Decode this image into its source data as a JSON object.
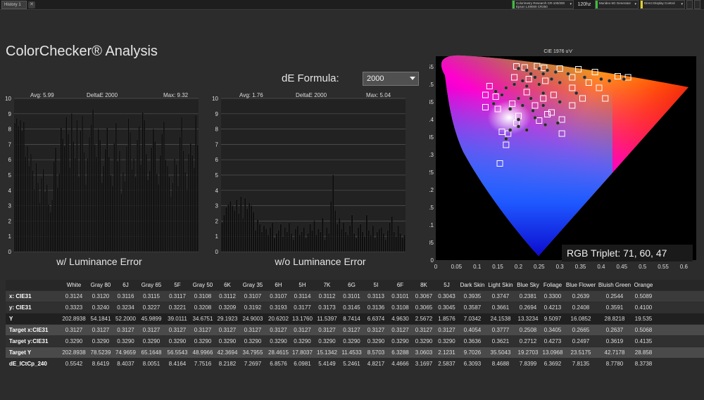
{
  "tab": {
    "label": "History 1"
  },
  "devices": [
    {
      "line1": "Colorimetry Research CR-100/200",
      "line2": "Epson LS9000 CR250",
      "color": "#3bbf3b"
    },
    {
      "line1": "Murideo 6G Generator",
      "line2": "",
      "color": "#3bbf3b"
    },
    {
      "line1": "Direct Display Control",
      "line2": "",
      "color": "#e3d02a"
    }
  ],
  "refresh": "120hz",
  "title": "ColorChecker® Analysis",
  "de_formula": {
    "label": "dE Formula:",
    "value": "2000"
  },
  "charts": [
    {
      "avg": "Avg: 5.99",
      "name": "DeltaE 2000",
      "max": "Max: 9.32",
      "caption": "w/ Luminance Error"
    },
    {
      "avg": "Avg: 1.76",
      "name": "DeltaE 2000",
      "max": "Max: 5.04",
      "caption": "w/o Luminance Error"
    }
  ],
  "chart_data": [
    {
      "type": "bar",
      "title": "DeltaE 2000",
      "ylim": [
        0,
        10
      ],
      "yticks": [
        "0",
        "1",
        "2",
        "3",
        "4",
        "5",
        "6",
        "7",
        "8",
        "9",
        "10"
      ],
      "values": [
        8.4,
        8.7,
        8.2,
        8.6,
        7.9,
        8.5,
        6.2,
        6.9,
        5.6,
        6.4,
        5.3,
        4.1,
        5.8,
        4.5,
        3.2,
        4.8,
        5.4,
        3.9,
        4.4,
        3.1,
        2.6,
        3.4,
        5.9,
        6.8,
        4.2,
        5.1,
        8.1,
        7.4,
        6.9,
        8.8,
        7.7,
        5.5,
        9.0,
        7.2,
        6.1,
        8.6,
        4.9,
        7.9,
        8.9,
        6.5,
        4.4,
        6.1,
        7.5,
        8.3,
        9.3,
        7.0,
        6.2,
        8.0,
        7.3,
        4.5,
        5.6,
        6.7,
        8.1,
        6.2,
        5.0,
        4.3,
        7.1,
        8.4,
        5.9,
        6.6,
        3.8,
        5.2,
        4.6,
        6.9,
        8.7,
        7.8,
        5.4,
        6.1,
        4.9,
        7.3,
        8.2,
        5.7,
        9.1,
        8.6,
        6.4,
        4.7,
        5.3,
        6.8,
        8.0,
        7.2,
        5.1,
        4.4,
        6.3,
        7.7,
        8.5,
        6.0,
        5.6,
        4.9,
        3.6,
        4.5,
        6.1,
        5.7,
        4.3,
        7.5,
        8.8,
        6.6,
        5.2,
        4.1,
        6.4,
        7.1,
        6.3,
        5.5,
        8.9,
        7.0
      ]
    },
    {
      "type": "bar",
      "title": "DeltaE 2000",
      "ylim": [
        0,
        10
      ],
      "yticks": [
        "0",
        "1",
        "2",
        "3",
        "4",
        "5",
        "6",
        "7",
        "8",
        "9",
        "10"
      ],
      "values": [
        1.9,
        2.4,
        2.9,
        3.1,
        3.3,
        3.0,
        2.7,
        3.4,
        2.5,
        3.6,
        2.2,
        3.5,
        2.8,
        3.2,
        3.0,
        2.6,
        1.4,
        2.1,
        1.8,
        1.3,
        1.7,
        1.5,
        1.1,
        1.6,
        1.9,
        0.9,
        1.2,
        1.4,
        1.8,
        1.0,
        1.6,
        1.3,
        1.9,
        1.2,
        0.8,
        1.5,
        1.7,
        1.1,
        1.3,
        1.6,
        0.9,
        1.2,
        1.8,
        1.4,
        2.0,
        1.1,
        1.5,
        1.3,
        2.2,
        0.8,
        1.6,
        1.2,
        3.3,
        5.0,
        2.7,
        1.8,
        2.2,
        1.5,
        1.9,
        1.3,
        1.1,
        1.7,
        2.4,
        1.2,
        0.9,
        1.6,
        1.8,
        1.3,
        1.0,
        2.4,
        1.4,
        1.1,
        1.7,
        0.9,
        1.3,
        1.5,
        1.6,
        1.2,
        0.8,
        1.4,
        1.9,
        2.3,
        1.3,
        1.0,
        1.7,
        1.2,
        0.9,
        1.1
      ]
    }
  ],
  "cie": {
    "title": "CIE 1976 u'v'",
    "x_ticks": [
      "0",
      "0.05",
      "0.1",
      "0.15",
      "0.2",
      "0.25",
      "0.3",
      "0.35",
      "0.4",
      "0.45",
      "0.5",
      "0.55",
      "0.6"
    ],
    "y_ticks": [
      "0",
      "0.05",
      "0.1",
      "0.15",
      "0.2",
      "0.25",
      "0.3",
      "0.35",
      "0.4",
      "0.45",
      "0.5",
      "0.55"
    ],
    "rgb_triplet": "RGB Triplet: 71, 60, 47"
  },
  "table": {
    "columns": [
      "White",
      "Gray 80",
      "6J",
      "Gray 65",
      "5F",
      "Gray 50",
      "6K",
      "Gray 35",
      "6H",
      "5H",
      "7K",
      "6G",
      "5I",
      "6F",
      "8K",
      "5J",
      "Dark Skin",
      "Light Skin",
      "Blue Sky",
      "Foliage",
      "Blue Flower",
      "Bluish Green",
      "Orange"
    ],
    "rows": [
      {
        "label": "x: CIE31",
        "values": [
          "0.3124",
          "0.3120",
          "0.3116",
          "0.3115",
          "0.3117",
          "0.3108",
          "0.3112",
          "0.3107",
          "0.3107",
          "0.3114",
          "0.3112",
          "0.3101",
          "0.3113",
          "0.3101",
          "0.3067",
          "0.3043",
          "0.3935",
          "0.3747",
          "0.2381",
          "0.3300",
          "0.2639",
          "0.2544",
          "0.5089"
        ]
      },
      {
        "label": "y: CIE31",
        "values": [
          "0.3323",
          "0.3240",
          "0.3234",
          "0.3227",
          "0.3221",
          "0.3208",
          "0.3209",
          "0.3192",
          "0.3193",
          "0.3177",
          "0.3173",
          "0.3145",
          "0.3136",
          "0.3108",
          "0.3065",
          "0.3045",
          "0.3587",
          "0.3661",
          "0.2694",
          "0.4213",
          "0.2408",
          "0.3591",
          "0.4100"
        ]
      },
      {
        "label": "Y",
        "values": [
          "202.8938",
          "54.1841",
          "52.2000",
          "45.9899",
          "39.0111",
          "34.6751",
          "29.1923",
          "24.9003",
          "20.6202",
          "13.1760",
          "11.5397",
          "8.7414",
          "6.6374",
          "4.9630",
          "2.5672",
          "1.8576",
          "7.0342",
          "24.1538",
          "13.3234",
          "9.5097",
          "16.0852",
          "28.8218",
          "19.535"
        ]
      },
      {
        "label": "Target x:CIE31",
        "values": [
          "0.3127",
          "0.3127",
          "0.3127",
          "0.3127",
          "0.3127",
          "0.3127",
          "0.3127",
          "0.3127",
          "0.3127",
          "0.3127",
          "0.3127",
          "0.3127",
          "0.3127",
          "0.3127",
          "0.3127",
          "0.3127",
          "0.4054",
          "0.3777",
          "0.2508",
          "0.3405",
          "0.2665",
          "0.2637",
          "0.5068"
        ]
      },
      {
        "label": "Target y:CIE31",
        "values": [
          "0.3290",
          "0.3290",
          "0.3290",
          "0.3290",
          "0.3290",
          "0.3290",
          "0.3290",
          "0.3290",
          "0.3290",
          "0.3290",
          "0.3290",
          "0.3290",
          "0.3290",
          "0.3290",
          "0.3290",
          "0.3290",
          "0.3636",
          "0.3621",
          "0.2712",
          "0.4273",
          "0.2497",
          "0.3619",
          "0.4135"
        ]
      },
      {
        "label": "Target Y",
        "values": [
          "202.8938",
          "78.5239",
          "74.9659",
          "65.1648",
          "56.5543",
          "48.9966",
          "42.3694",
          "34.7955",
          "28.4615",
          "17.8037",
          "15.1342",
          "11.4533",
          "8.5703",
          "6.3288",
          "3.0603",
          "2.1231",
          "9.7026",
          "35.5043",
          "19.2703",
          "13.0968",
          "23.5175",
          "42.7178",
          "28.858"
        ]
      },
      {
        "label": "dE_ICtCp_240",
        "values": [
          "0.5542",
          "8.6419",
          "8.4037",
          "8.0051",
          "8.4164",
          "7.7516",
          "8.2182",
          "7.2697",
          "6.8576",
          "6.0981",
          "5.4149",
          "5.2461",
          "4.8217",
          "4.4666",
          "3.1697",
          "2.5837",
          "6.3093",
          "8.4688",
          "7.8399",
          "6.3692",
          "7.8135",
          "8.7780",
          "8.3738"
        ]
      }
    ]
  }
}
